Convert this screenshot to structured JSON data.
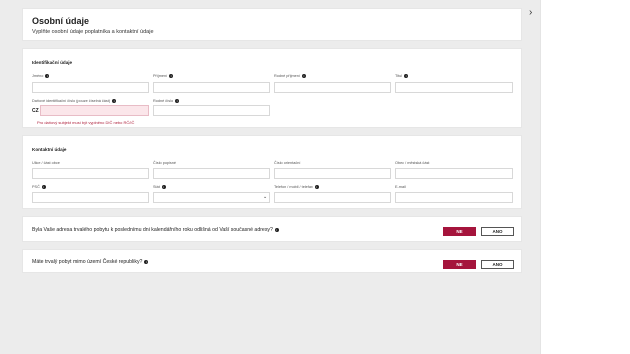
{
  "header": {
    "title": "Osobní údaje",
    "subtitle": "Vyplňte osobní údaje poplatníka a kontaktní údaje"
  },
  "identification": {
    "section_title": "Identifikační údaje",
    "jmeno_label": "Jméno",
    "prijmeni_label": "Příjmení",
    "rodne_prijmeni_label": "Rodné příjmení",
    "titul_label": "Titul",
    "dic_label": "Daňové identifikační číslo (pouze číselná část)",
    "dic_prefix": "CZ",
    "rodne_cislo_label": "Rodné číslo",
    "error": "Pro daňový subjekt musí být vyplněno DIČ nebo RČ/IČ"
  },
  "contact": {
    "section_title": "Kontaktní údaje",
    "ulice_label": "Ulice / část obce",
    "cislo_popisne_label": "Číslo popisné",
    "cislo_orientacni_label": "Číslo orientační",
    "obec_label": "Obec / městská část",
    "psc_label": "PSČ",
    "stat_label": "Stát",
    "telefon_label": "Telefon / mobil / telefax",
    "email_label": "E-mail"
  },
  "questions": [
    {
      "text": "Byla Vaše adresa trvalého pobytu k poslednímu dni kalendářního roku odlišná od Vaší současné adresy?",
      "no": "NE",
      "yes": "ANO"
    },
    {
      "text": "Máte trvalý pobyt mimo území České republiky?",
      "no": "NE",
      "yes": "ANO"
    }
  ],
  "icons": {
    "info": "info-icon",
    "chevron": "chevron-right-icon",
    "dropdown": "chevron-down-icon"
  },
  "colors": {
    "accent": "#a5143c",
    "error_text": "#b0243f",
    "error_bg": "#fbe6ea"
  }
}
